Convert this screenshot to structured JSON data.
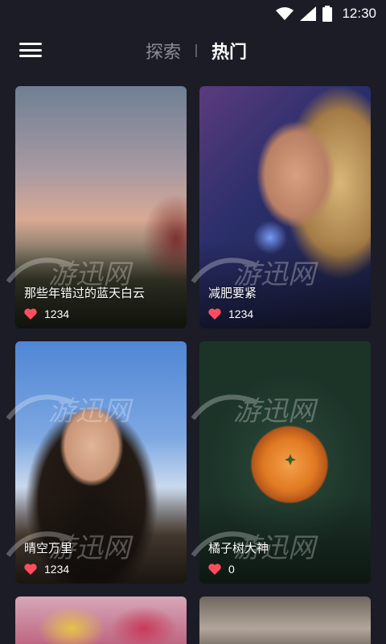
{
  "status_bar": {
    "time": "12:30",
    "icons": [
      "wifi-icon",
      "cell-signal-icon",
      "battery-icon"
    ]
  },
  "header": {
    "menu_icon": "hamburger-menu-icon",
    "tabs": [
      {
        "label": "探索",
        "active": false
      },
      {
        "label": "热门",
        "active": true
      }
    ]
  },
  "feed": {
    "cards": [
      {
        "title": "那些年错过的蓝天白云",
        "likes": "1234"
      },
      {
        "title": "减肥要紧",
        "likes": "1234"
      },
      {
        "title": "晴空万里",
        "likes": "1234"
      },
      {
        "title": "橘子树大神",
        "likes": "0"
      },
      {
        "title": "",
        "likes": ""
      },
      {
        "title": "",
        "likes": ""
      }
    ]
  },
  "watermark": {
    "text": "游迅网"
  },
  "colors": {
    "background": "#1b1c25",
    "heart": "#ff4d5e",
    "tab_inactive": "#8a8b93",
    "tab_active": "#ffffff"
  }
}
